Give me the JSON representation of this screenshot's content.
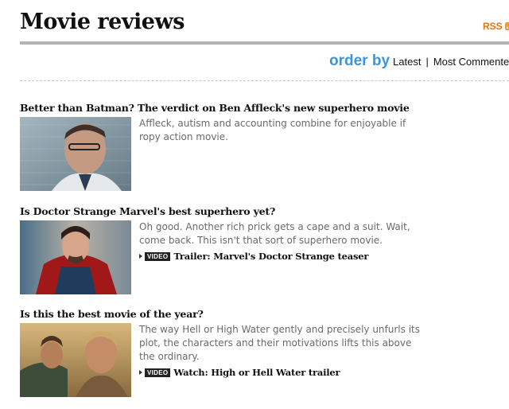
{
  "page": {
    "title": "Movie reviews"
  },
  "rss": {
    "label": "RSS",
    "icon": "rss-icon"
  },
  "order": {
    "label": "order by",
    "options": [
      "Latest",
      "Most Commented"
    ],
    "separator": "|"
  },
  "articles": [
    {
      "headline": "Better than Batman? The verdict on Ben Affleck's new superhero movie",
      "summary": "Affleck, autism and accounting combine for enjoyable if ropy action movie."
    },
    {
      "headline": "Is Doctor Strange Marvel's best superhero yet?",
      "summary": "Oh good. Another rich prick gets a cape and a suit. Wait, come back. This isn't that sort of superhero movie.",
      "video": {
        "badge": "VIDEO",
        "label": "Trailer: Marvel's Doctor Strange teaser"
      }
    },
    {
      "headline": "Is this the best movie of the year?",
      "summary": "The way Hell or High Water gently and precisely unfurls its plot, the characters and their motivations lifts this above the ordinary.",
      "video": {
        "badge": "VIDEO",
        "label": "Watch: High or Hell Water trailer"
      }
    }
  ],
  "colors": {
    "accent": "#3c95db",
    "rss": "#e8720c",
    "rule": "#b3b3b3"
  }
}
